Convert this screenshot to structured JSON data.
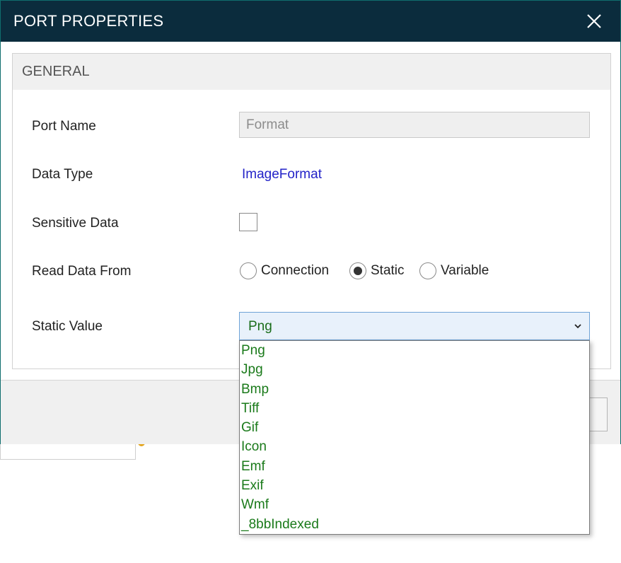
{
  "dialog": {
    "title": "PORT PROPERTIES"
  },
  "group": {
    "title": "GENERAL"
  },
  "fields": {
    "port_name": {
      "label": "Port Name",
      "value": "Format"
    },
    "data_type": {
      "label": "Data Type",
      "value": "ImageFormat"
    },
    "sensitive_data": {
      "label": "Sensitive Data",
      "checked": false
    },
    "read_data_from": {
      "label": "Read Data From",
      "options": [
        "Connection",
        "Static",
        "Variable"
      ],
      "selected": "Static"
    },
    "static_value": {
      "label": "Static Value",
      "selected": "Png"
    }
  },
  "dropdown": {
    "options": [
      "Png",
      "Jpg",
      "Bmp",
      "Tiff",
      "Gif",
      "Icon",
      "Emf",
      "Exif",
      "Wmf",
      "_8bbIndexed"
    ]
  },
  "colors": {
    "titlebar": "#0b2c3d",
    "value_link": "#2323c8",
    "option_text": "#1a7a1a",
    "select_border": "#6fa3d6"
  },
  "icons": {
    "close": "close-icon",
    "chevron": "chevron-down-icon"
  }
}
